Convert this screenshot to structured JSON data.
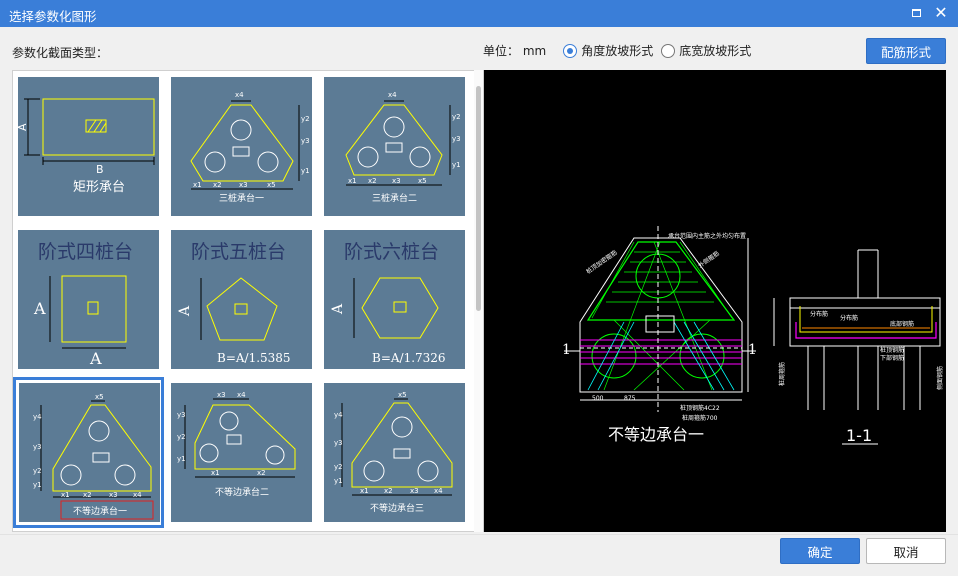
{
  "window": {
    "title": "选择参数化图形"
  },
  "section_label": "参数化截面类型：",
  "unit": {
    "label": "单位：",
    "value": "mm"
  },
  "slope_modes": [
    {
      "label": "角度放坡形式",
      "selected": true
    },
    {
      "label": "底宽放坡形式",
      "selected": false
    }
  ],
  "rebar_button": "配筋形式",
  "ok_button": "确定",
  "cancel_button": "取消",
  "gallery": {
    "tiles": [
      {
        "name": "矩形承台",
        "labels": [
          "A",
          "B"
        ]
      },
      {
        "name": "三桩承台一",
        "labels": [
          "x4",
          "y2",
          "y3",
          "y1",
          "x1",
          "x2",
          "x3",
          "x5"
        ]
      },
      {
        "name": "三桩承台二",
        "labels": [
          "x4",
          "y2",
          "y3",
          "y1",
          "x1",
          "x2",
          "x3",
          "x5"
        ]
      },
      {
        "name": "阶式四桩台",
        "labels": [
          "A",
          "A"
        ]
      },
      {
        "name": "阶式五桩台",
        "labels": [
          "A",
          "B=A/1.5385"
        ]
      },
      {
        "name": "阶式六桩台",
        "labels": [
          "A",
          "B=A/1.7326"
        ]
      },
      {
        "name": "不等边承台一",
        "labels": [
          "x5",
          "y4",
          "y3",
          "y2",
          "y1",
          "x1",
          "x2",
          "x3",
          "x4"
        ]
      },
      {
        "name": "不等边承台二",
        "labels": [
          "x3",
          "x4",
          "y3",
          "y2",
          "y1",
          "x1",
          "x2"
        ]
      },
      {
        "name": "不等边承台三",
        "labels": [
          "x5",
          "y4",
          "y3",
          "y2",
          "y1",
          "x1",
          "x2",
          "x3",
          "x4"
        ]
      }
    ],
    "selected_index": 6
  },
  "preview": {
    "plan_title": "不等边承台一",
    "section_title": "1-1",
    "section_marks": [
      "1",
      "1"
    ],
    "notes": [
      "承台范围内主筋之外均匀布置",
      "桩顶加密箍筋",
      "外侧箍筋",
      "桩顶钢筋4C22",
      "桩周箍筋700",
      "分布筋",
      "分布筋",
      "底部钢筋",
      "桩顶钢筋",
      "下部钢筋",
      "桩周箍筋",
      "侧面钢筋"
    ],
    "dims": [
      "500",
      "875"
    ]
  },
  "colors": {
    "accent": "#3a7ed8",
    "tile_bg": "#5c7b95",
    "cad_yellow": "#ffff00",
    "cad_green": "#00ff00",
    "cad_magenta": "#ff00ff",
    "cad_cyan": "#00ffff"
  }
}
